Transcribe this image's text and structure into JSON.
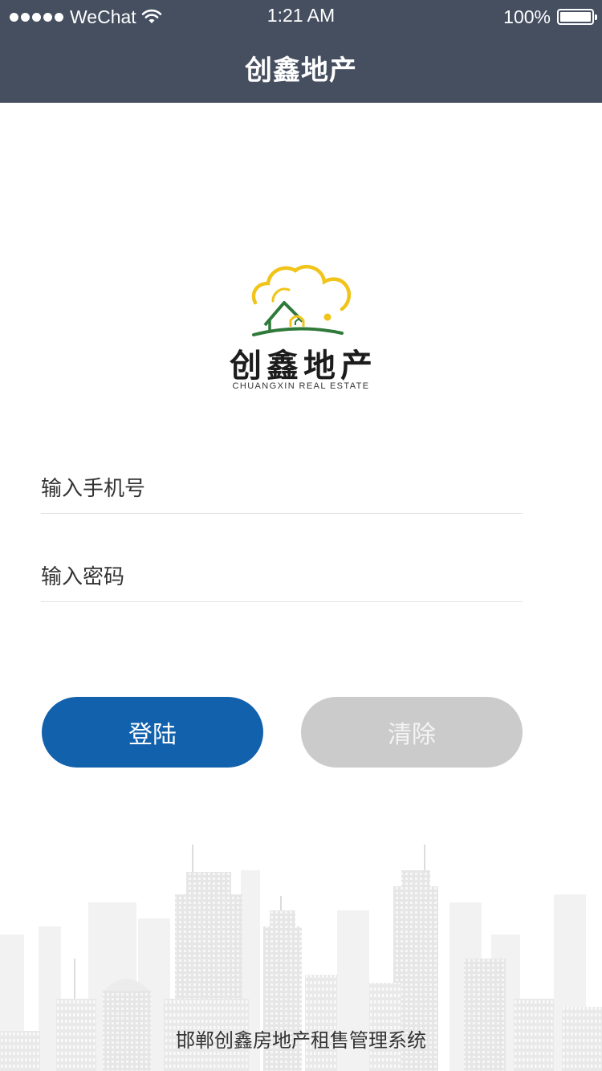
{
  "status_bar": {
    "carrier": "WeChat",
    "time": "1:21 AM",
    "battery": "100%",
    "battery_level": 1.0
  },
  "nav": {
    "title": "创鑫地产"
  },
  "logo": {
    "name_cn": "创鑫地产",
    "name_en": "CHUANGXIN REAL ESTATE"
  },
  "form": {
    "phone_placeholder": "输入手机号",
    "phone_value": "",
    "password_placeholder": "输入密码",
    "password_value": ""
  },
  "buttons": {
    "login_label": "登陆",
    "clear_label": "清除"
  },
  "footer": {
    "text": "邯郸创鑫房地产租售管理系统"
  },
  "colors": {
    "nav_bg": "#454f60",
    "login_bg": "#1261ad",
    "clear_bg": "#cbcbcb",
    "logo_yellow": "#f0c419",
    "logo_green": "#2f7a3a"
  },
  "icons": [
    "signal-dots-icon",
    "wifi-icon",
    "battery-icon",
    "logo-emblem-icon",
    "skyline-illustration"
  ]
}
